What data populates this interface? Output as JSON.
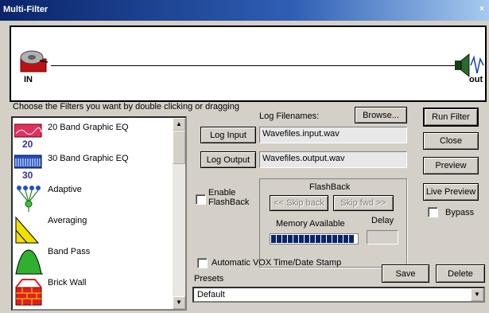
{
  "window": {
    "title": "Multi-Filter",
    "close_glyph": "×"
  },
  "canvas": {
    "in_label": "IN",
    "out_label": "out"
  },
  "filters": {
    "instruction": "Choose the Filters you want by double clicking or dragging",
    "items": [
      {
        "label": "20 Band Graphic EQ",
        "icon_text": "20",
        "icon": "eq20-icon"
      },
      {
        "label": "30 Band Graphic EQ",
        "icon_text": "30",
        "icon": "eq30-icon"
      },
      {
        "label": "Adaptive",
        "icon": "adaptive-icon"
      },
      {
        "label": "Averaging",
        "icon": "averaging-icon"
      },
      {
        "label": "Band Pass",
        "icon": "bandpass-icon"
      },
      {
        "label": "Brick Wall",
        "icon": "brickwall-icon"
      }
    ]
  },
  "log": {
    "filenames_label": "Log Filenames:",
    "browse_label": "Browse...",
    "input_button": "Log Input",
    "input_value": "Wavefiles.input.wav",
    "output_button": "Log Output",
    "output_value": "Wavefiles.output.wav"
  },
  "actions": {
    "run_filter": "Run Filter",
    "close": "Close",
    "preview": "Preview",
    "live_preview": "Live Preview",
    "bypass": "Bypass"
  },
  "flashback": {
    "enable_label_line1": "Enable",
    "enable_label_line2": "FlashBack",
    "title": "FlashBack",
    "skip_back": "<< Skip back",
    "skip_fwd": "Skip fwd >>",
    "memory_label": "Memory Available",
    "memory_level": 1.0,
    "delay_label": "Delay"
  },
  "vox": {
    "label": "Automatic VOX Time/Date Stamp"
  },
  "presets": {
    "label": "Presets",
    "selected": "Default",
    "save_button": "Save",
    "delete_button": "Delete"
  }
}
